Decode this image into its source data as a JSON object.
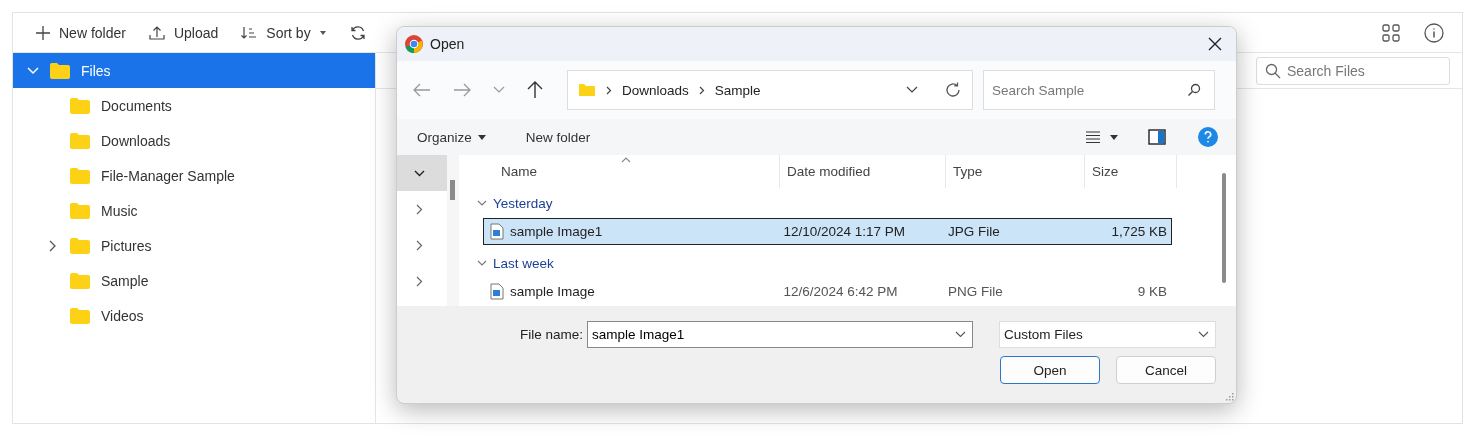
{
  "file_manager": {
    "toolbar": [
      {
        "kind": "new",
        "label": "New folder"
      },
      {
        "kind": "upload",
        "label": "Upload"
      },
      {
        "kind": "sort",
        "label": "Sort by"
      },
      {
        "kind": "refresh"
      }
    ],
    "tree": [
      {
        "label": "Files",
        "selected": true,
        "kind": "expanded",
        "children": [
          {
            "label": "Documents",
            "selected": false,
            "kind": "leaf"
          },
          {
            "label": "Downloads",
            "selected": false,
            "kind": "leaf"
          },
          {
            "label": "File-Manager Sample",
            "selected": false,
            "kind": "leaf"
          },
          {
            "label": "Music",
            "selected": false,
            "kind": "leaf"
          },
          {
            "label": "Pictures",
            "selected": false,
            "kind": "collapsed"
          },
          {
            "label": "Sample",
            "selected": false,
            "kind": "leaf"
          },
          {
            "label": "Videos",
            "selected": false,
            "kind": "leaf"
          }
        ]
      }
    ],
    "search": {
      "placeholder": "Search Files"
    }
  },
  "dialog": {
    "title": "Open",
    "address": [
      "Downloads",
      "Sample"
    ],
    "search": {
      "placeholder": "Search Sample"
    },
    "commands": [
      {
        "label": "Organize",
        "dropdown": true
      },
      {
        "label": "New folder",
        "dropdown": false
      }
    ],
    "nav_pane": [
      {
        "selected": true,
        "expanded": true
      },
      {
        "selected": false,
        "expanded": false
      },
      {
        "selected": false,
        "expanded": false
      },
      {
        "selected": false,
        "expanded": false
      }
    ],
    "columns": [
      {
        "label": "Name",
        "sorted": true
      },
      {
        "label": "Date modified",
        "sorted": false
      },
      {
        "label": "Type",
        "sorted": false
      },
      {
        "label": "Size",
        "sorted": false
      }
    ],
    "groups": [
      {
        "label": "Yesterday",
        "expanded": true,
        "files": [
          {
            "name": "sample Image1",
            "date": "12/10/2024 1:17 PM",
            "type": "JPG File",
            "size": "1,725 KB",
            "selected": true
          }
        ]
      },
      {
        "label": "Last week",
        "expanded": true,
        "files": [
          {
            "name": "sample Image",
            "date": "12/6/2024 6:42 PM",
            "type": "PNG File",
            "size": "9 KB",
            "selected": false
          }
        ]
      }
    ],
    "file_name_label": "File name:",
    "file_name": "sample Image1",
    "filter": "Custom Files",
    "buttons": [
      {
        "label": "Open",
        "default": true
      },
      {
        "label": "Cancel",
        "default": false
      }
    ]
  }
}
